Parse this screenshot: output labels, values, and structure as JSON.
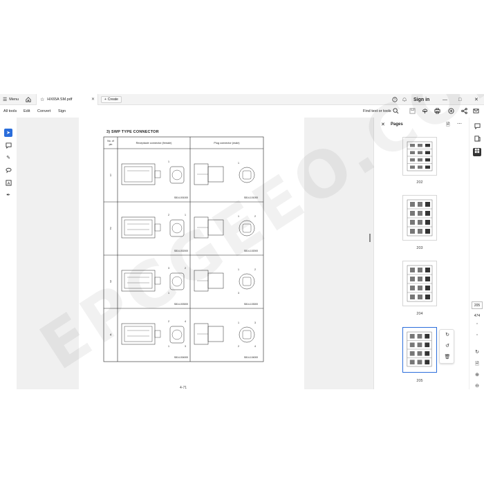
{
  "topbar": {
    "menu_label": "Menu",
    "tab_title": "HX65A SM.pdf",
    "create_label": "Create",
    "signin_label": "Sign in"
  },
  "toolbar": {
    "items": [
      "All tools",
      "Edit",
      "Convert",
      "Sign"
    ],
    "search_label": "Find text or tools"
  },
  "document": {
    "heading": "3) SWP TYPE CONNECTOR",
    "page_number": "4-71",
    "table": {
      "headers": [
        "No. of pin",
        "Receptacle connector (female)",
        "Plug connector (male)"
      ],
      "rows": [
        {
          "pins": "1",
          "female_code": "S814-001000",
          "male_code": "S814-101000",
          "female_callouts": [
            "1"
          ],
          "male_callouts": [
            "1"
          ]
        },
        {
          "pins": "2",
          "female_code": "S814-002000",
          "male_code": "S814-102000",
          "female_callouts": [
            "2",
            "1"
          ],
          "male_callouts": [
            "1",
            "2"
          ]
        },
        {
          "pins": "3",
          "female_code": "S814-003000",
          "male_code": "S814-103000",
          "female_callouts": [
            "3",
            "2",
            "1"
          ],
          "male_callouts": [
            "1",
            "2",
            "3"
          ]
        },
        {
          "pins": "4",
          "female_code": "S814-004000",
          "male_code": "S814-104000",
          "female_callouts": [
            "2",
            "4",
            "1",
            "3"
          ],
          "male_callouts": [
            "1",
            "3",
            "2",
            "4"
          ]
        }
      ]
    }
  },
  "watermark": "EPCGEEO.COM",
  "pages_panel": {
    "title": "Pages",
    "thumbnails": [
      {
        "label": "202",
        "selected": false
      },
      {
        "label": "203",
        "selected": false
      },
      {
        "label": "204",
        "selected": false
      },
      {
        "label": "205",
        "selected": true
      }
    ]
  },
  "pagination": {
    "current": "205",
    "total": "474"
  },
  "colors": {
    "accent": "#2a6ddb",
    "panel_bg": "#f0f0f0"
  }
}
